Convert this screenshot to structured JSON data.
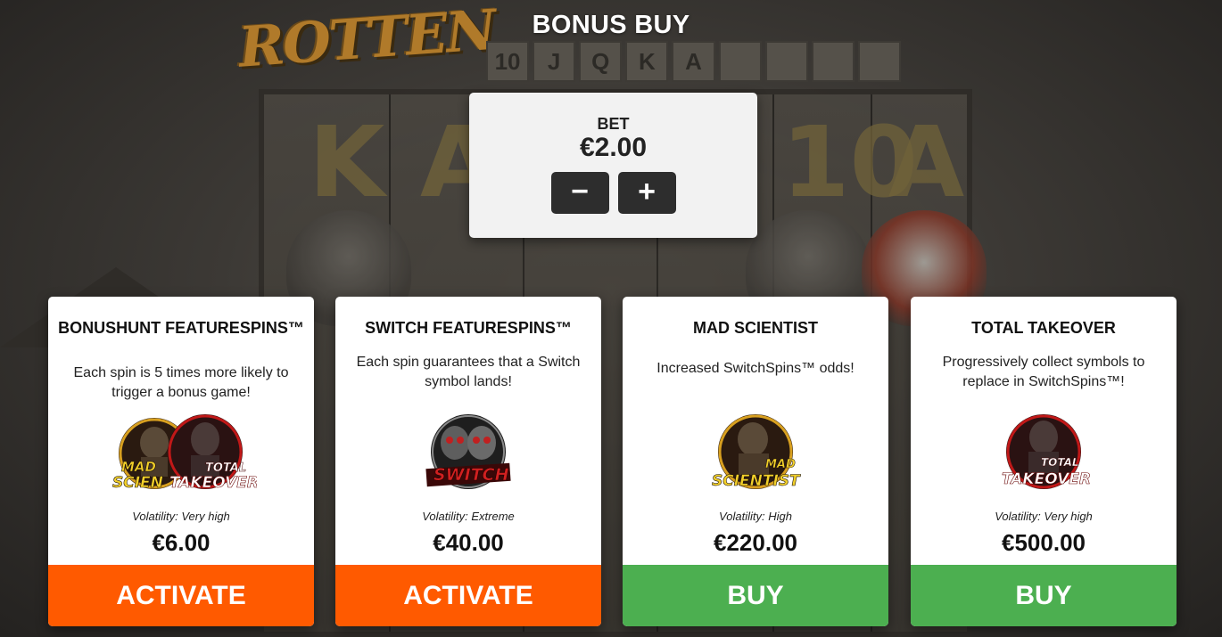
{
  "title": "BONUS BUY",
  "background": {
    "logo_text": "ROTTEN",
    "strip_symbols": [
      "10",
      "J",
      "Q",
      "K",
      "A",
      "",
      "",
      "",
      ""
    ],
    "reel_letters": [
      "K",
      "A",
      "10",
      "A"
    ]
  },
  "bet": {
    "label": "BET",
    "value": "€2.00",
    "minus_label": "−",
    "plus_label": "+"
  },
  "cards": [
    {
      "title": "BONUSHUNT FEATURESPINS™",
      "description": "Each spin is 5 times more likely to trigger a bonus game!",
      "badge_words": [
        "MAD",
        "SCIEN",
        "TOTAL",
        "TAKEOVER"
      ],
      "volatility": "Volatility: Very high",
      "price": "€6.00",
      "action": "ACTIVATE",
      "action_color": "#ff5a00"
    },
    {
      "title": "SWITCH FEATURESPINS™",
      "description": "Each spin guarantees that a Switch symbol lands!",
      "badge_words": [
        "SWITCH"
      ],
      "volatility": "Volatility: Extreme",
      "price": "€40.00",
      "action": "ACTIVATE",
      "action_color": "#ff5a00"
    },
    {
      "title": "MAD SCIENTIST",
      "description": "Increased SwitchSpins™ odds!",
      "badge_words": [
        "MAD",
        "SCIENTIST"
      ],
      "volatility": "Volatility: High",
      "price": "€220.00",
      "action": "BUY",
      "action_color": "#4caf50"
    },
    {
      "title": "TOTAL TAKEOVER",
      "description": "Progressively collect symbols to replace in SwitchSpins™!",
      "badge_words": [
        "TOTAL",
        "TAKEOVER"
      ],
      "volatility": "Volatility: Very high",
      "price": "€500.00",
      "action": "BUY",
      "action_color": "#4caf50"
    }
  ]
}
